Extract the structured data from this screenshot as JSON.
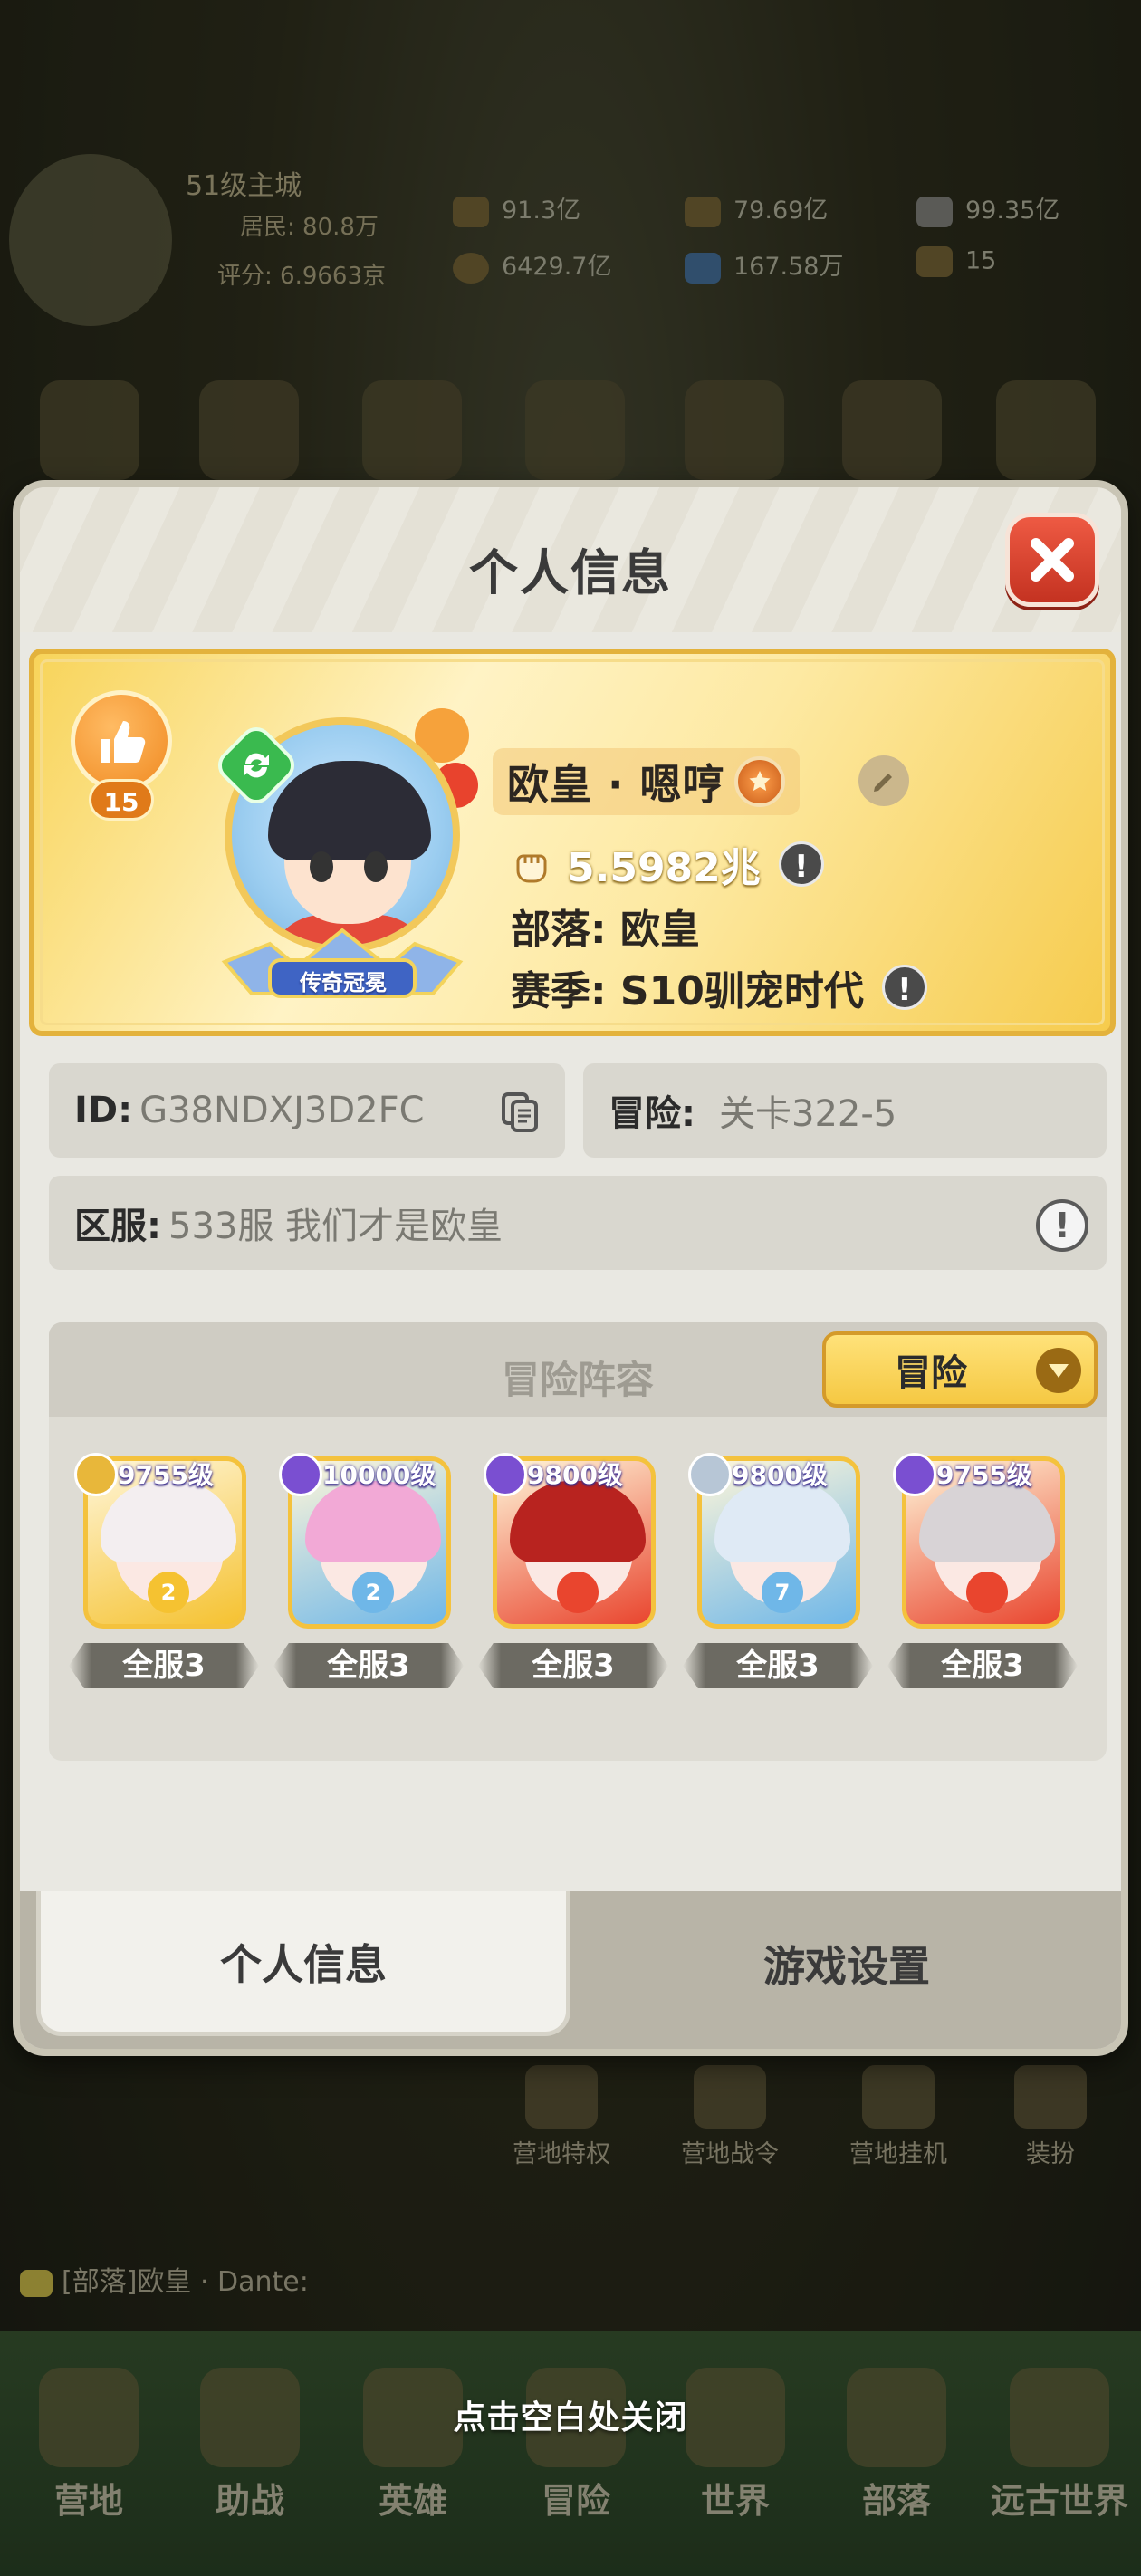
{
  "background": {
    "city_level": "51级主城",
    "residents": "居民: 80.8万",
    "rating": "评分: 6.9663京",
    "resources": [
      "91.3亿",
      "79.69亿",
      "99.35亿",
      "6429.7亿",
      "167.58万",
      "15"
    ],
    "shortcuts": [
      "营地特权",
      "营地战令",
      "营地挂机",
      "装扮"
    ],
    "chat": "[部落]欧皇 · Dante:",
    "nav": [
      "营地",
      "助战",
      "英雄",
      "冒险",
      "世界",
      "部落",
      "远古世界"
    ],
    "close_hint": "点击空白处关闭"
  },
  "modal": {
    "title": "个人信息",
    "profile": {
      "likes": "15",
      "crown_text": "传奇冠冕",
      "name": "欧皇 · 嗯哼",
      "power": "5.5982兆",
      "tribe": "部落: 欧皇",
      "season": "赛季: S10驯宠时代"
    },
    "id_label": "ID:",
    "id_value": "G38NDXJ3D2FC",
    "adventure_label": "冒险:",
    "adventure_value": "关卡322-5",
    "server_label": "区服:",
    "server_value": "533服 我们才是欧皇",
    "team": {
      "title": "冒险阵容",
      "mode": "冒险",
      "heroes": [
        {
          "level": "9755级",
          "star": "2",
          "rank": "全服3",
          "color": "#f5c231",
          "hair": "#f3eef0"
        },
        {
          "level": "10000级",
          "star": "2",
          "rank": "全服3",
          "color": "#6fb7e8",
          "hair": "#f2a9d6"
        },
        {
          "level": "9800级",
          "star": "",
          "rank": "全服3",
          "color": "#e9452e",
          "hair": "#b8231f"
        },
        {
          "level": "9800级",
          "star": "7",
          "rank": "全服3",
          "color": "#6fb7e8",
          "hair": "#dfeaf5"
        },
        {
          "level": "9755级",
          "star": "",
          "rank": "全服3",
          "color": "#e9452e",
          "hair": "#d8d3d6"
        }
      ]
    },
    "tabs": [
      "个人信息",
      "游戏设置"
    ]
  }
}
